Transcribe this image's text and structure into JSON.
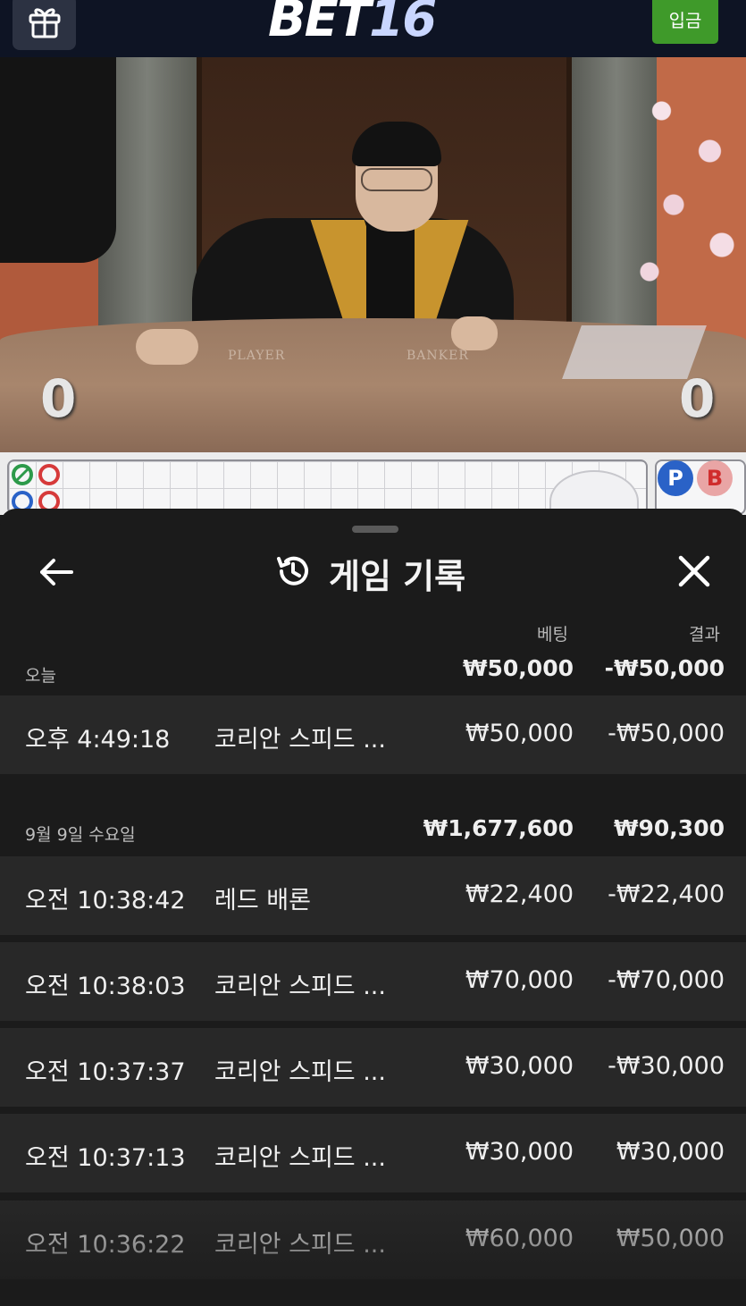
{
  "header": {
    "logo_main": "BET",
    "logo_num": "16",
    "deposit_label": "입금",
    "gift_icon": "gift-icon"
  },
  "video": {
    "table_player_label": "PLAYER",
    "table_banker_label": "BANKER",
    "player_score": "0",
    "banker_score": "0"
  },
  "roadmap": {
    "chip_player": "P",
    "chip_banker": "B"
  },
  "history": {
    "title": "게임 기록",
    "columns": {
      "bet": "베팅",
      "result": "결과"
    },
    "groups": [
      {
        "label": "오늘",
        "bet_total": "₩50,000",
        "result_total": "-₩50,000",
        "rows": [
          {
            "time": "오후 4:49:18",
            "game": "코리안 스피드 ...",
            "bet": "₩50,000",
            "result": "-₩50,000"
          }
        ]
      },
      {
        "label": "9월 9일 수요일",
        "bet_total": "₩1,677,600",
        "result_total": "₩90,300",
        "rows": [
          {
            "time": "오전 10:38:42",
            "game": "레드 배론",
            "bet": "₩22,400",
            "result": "-₩22,400"
          },
          {
            "time": "오전 10:38:03",
            "game": "코리안 스피드 ...",
            "bet": "₩70,000",
            "result": "-₩70,000"
          },
          {
            "time": "오전 10:37:37",
            "game": "코리안 스피드 ...",
            "bet": "₩30,000",
            "result": "-₩30,000"
          },
          {
            "time": "오전 10:37:13",
            "game": "코리안 스피드 ...",
            "bet": "₩30,000",
            "result": "₩30,000"
          },
          {
            "time": "오전 10:36:22",
            "game": "코리안 스피드 ...",
            "bet": "₩60,000",
            "result": "₩50,000"
          }
        ]
      }
    ]
  },
  "colors": {
    "topbar": "#0e1424",
    "deposit": "#3f9a2a",
    "sheet": "#1b1b1b",
    "row": "#282828"
  }
}
